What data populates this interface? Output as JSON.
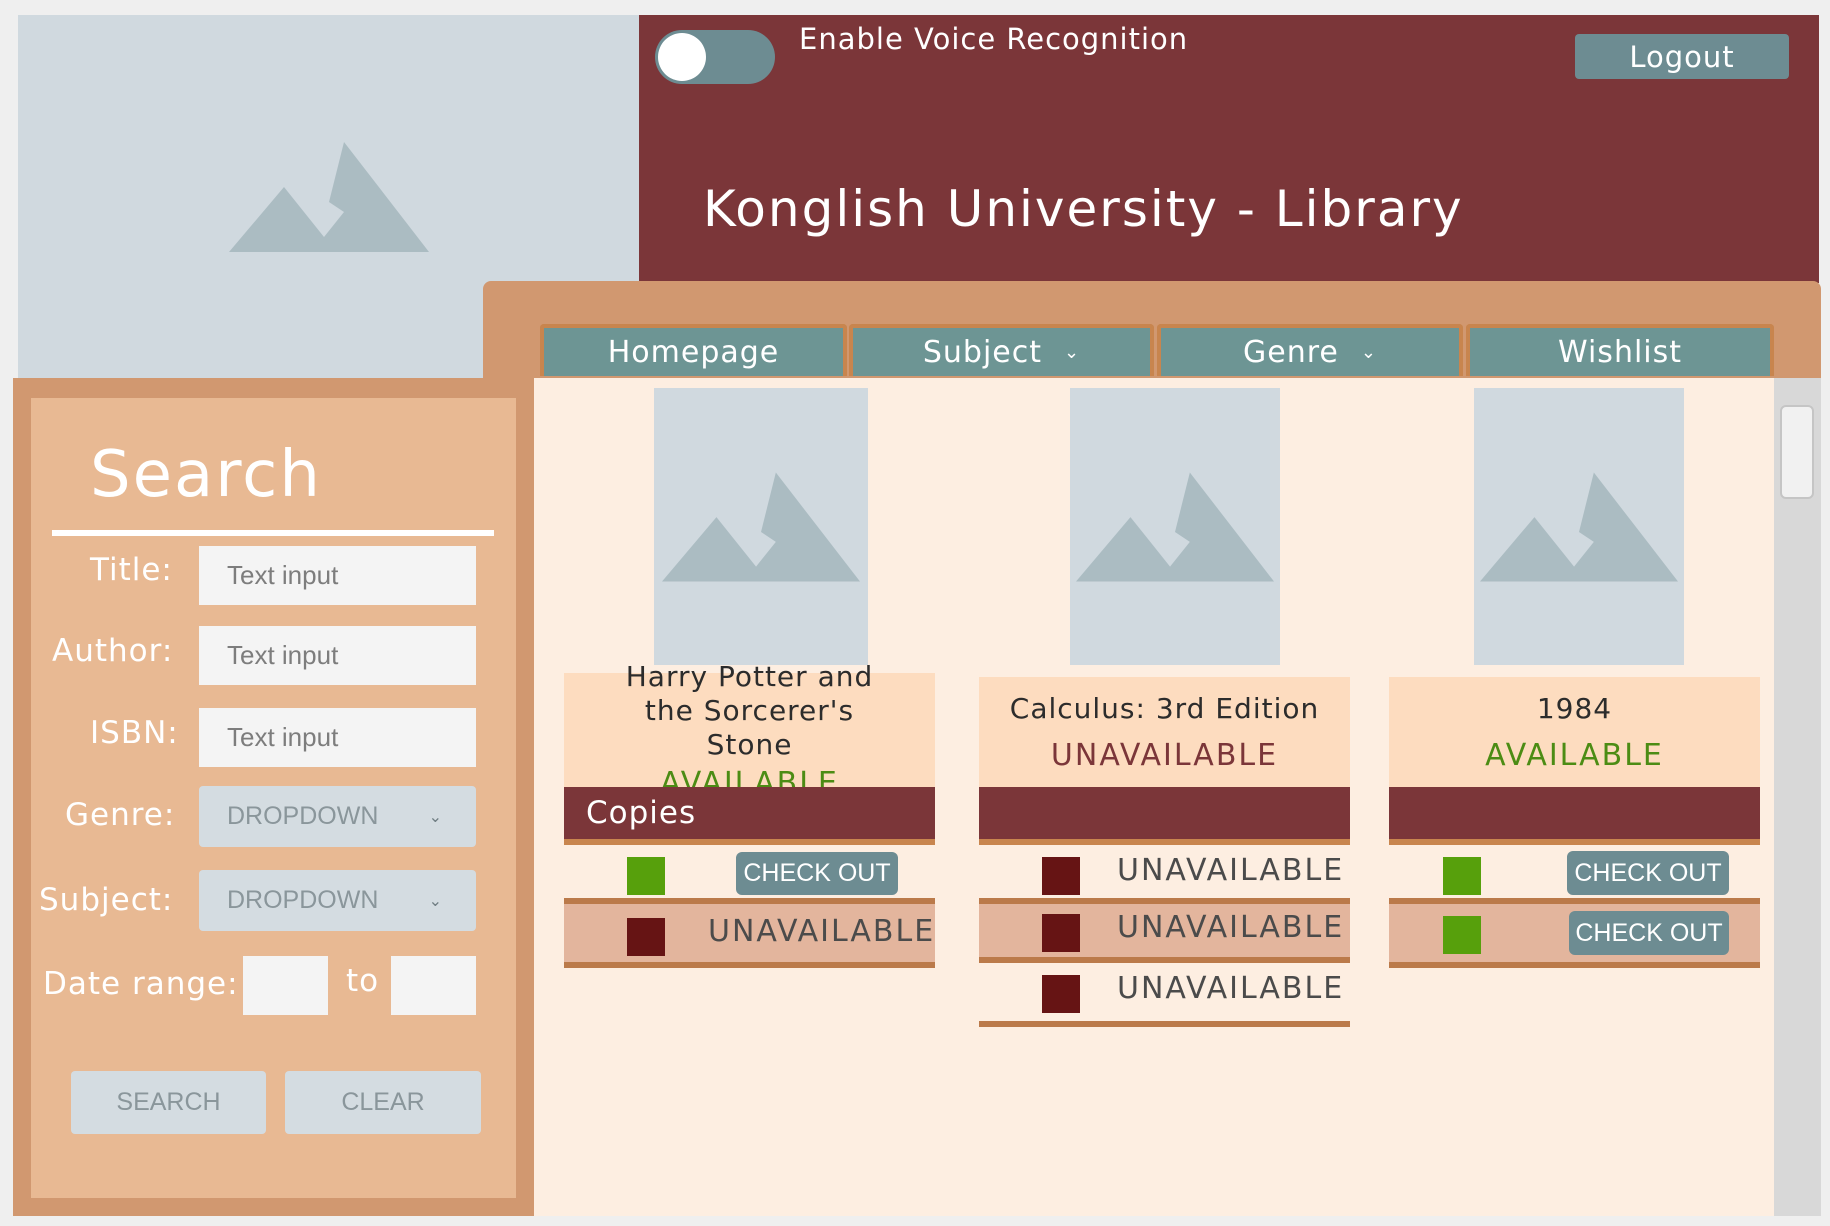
{
  "header": {
    "voice_toggle_label": "Enable Voice Recognition",
    "logout_label": "Logout",
    "site_title": "Konglish University - Library",
    "brand_color": "#7b3639"
  },
  "nav": {
    "tabs": [
      {
        "label": "Homepage",
        "icon": ""
      },
      {
        "label": "Subject",
        "icon": "chevron-down-icon"
      },
      {
        "label": "Genre",
        "icon": "chevron-down-icon"
      },
      {
        "label": "Wishlist",
        "icon": ""
      }
    ]
  },
  "search": {
    "heading": "Search",
    "title_label": "Title:",
    "title_placeholder": "Text input",
    "author_label": "Author:",
    "author_placeholder": "Text input",
    "isbn_label": "ISBN:",
    "isbn_placeholder": "Text input",
    "genre_label": "Genre:",
    "genre_value": "DROPDOWN",
    "subject_label": "Subject:",
    "subject_value": "DROPDOWN",
    "date_range_label": "Date range:",
    "date_to_label": "to",
    "search_button": "SEARCH",
    "clear_button": "CLEAR"
  },
  "books": [
    {
      "title": "Harry Potter and the Sorcerer's Stone",
      "status": "AVAILABLE",
      "status_color": "#4c8c14",
      "copies_header": "Copies",
      "copies": [
        {
          "status": "available",
          "action": "CHECK OUT"
        },
        {
          "status": "unavailable",
          "action": "UNAVAILABLE"
        }
      ]
    },
    {
      "title": "Calculus: 3rd Edition",
      "status": "UNAVAILABLE",
      "status_color": "#7b3639",
      "copies_header": "",
      "copies": [
        {
          "status": "unavailable",
          "action": "UNAVAILABLE"
        },
        {
          "status": "unavailable",
          "action": "UNAVAILABLE"
        },
        {
          "status": "unavailable",
          "action": "UNAVAILABLE"
        }
      ]
    },
    {
      "title": "1984",
      "status": "AVAILABLE",
      "status_color": "#4c8c14",
      "copies_header": "",
      "copies": [
        {
          "status": "available",
          "action": "CHECK OUT"
        },
        {
          "status": "available",
          "action": "CHECK OUT"
        }
      ]
    }
  ],
  "colors": {
    "accent_teal": "#6d8c92",
    "available_green": "#57a00c",
    "unavailable_red": "#661414"
  }
}
